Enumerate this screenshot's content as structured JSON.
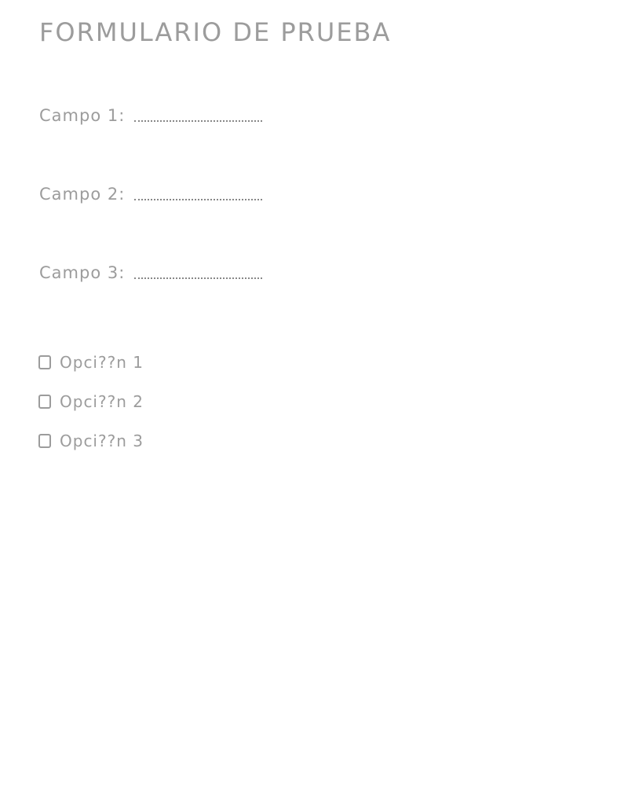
{
  "form": {
    "title": "FORMULARIO DE PRUEBA",
    "fields": [
      {
        "label": "Campo 1:"
      },
      {
        "label": "Campo 2:"
      },
      {
        "label": "Campo 3:"
      }
    ],
    "options": [
      {
        "label": "Opci??n 1",
        "checked": false
      },
      {
        "label": "Opci??n 2",
        "checked": false
      },
      {
        "label": "Opci??n 3",
        "checked": false
      }
    ]
  }
}
